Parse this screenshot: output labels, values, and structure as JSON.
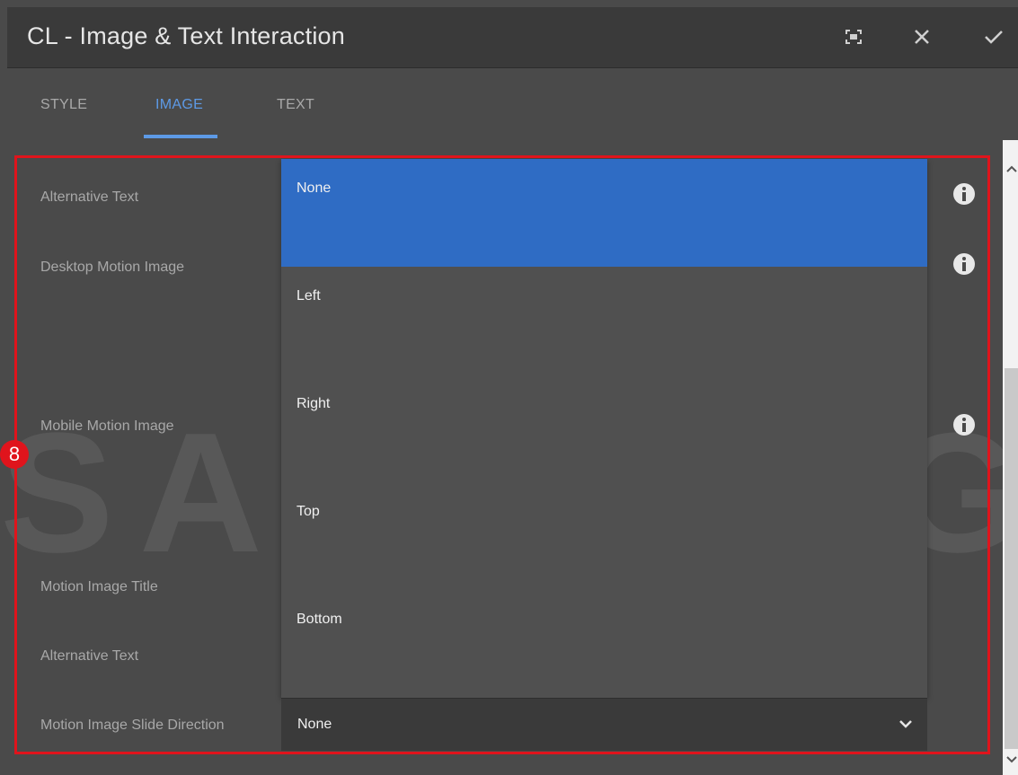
{
  "dialog": {
    "title": "CL - Image & Text Interaction",
    "fullscreen_icon": "fullscreen-icon",
    "close_icon": "close-icon",
    "confirm_icon": "check-icon"
  },
  "tabs": [
    {
      "label": "STYLE"
    },
    {
      "label": "IMAGE"
    },
    {
      "label": "TEXT"
    }
  ],
  "fields": [
    {
      "label": "Alternative Text"
    },
    {
      "label": "Desktop Motion Image"
    },
    {
      "label": "Mobile Motion Image"
    },
    {
      "label": "Motion Image Title"
    },
    {
      "label": "Alternative Text"
    },
    {
      "label": "Motion Image Slide Direction"
    }
  ],
  "dropdown": {
    "options": [
      {
        "label": "None"
      },
      {
        "label": "Left"
      },
      {
        "label": "Right"
      },
      {
        "label": "Top"
      },
      {
        "label": "Bottom"
      }
    ],
    "selected_value": "None"
  },
  "annotation": {
    "step_number": "8",
    "color": "#e0141c"
  },
  "watermark": "SAMSUNG",
  "colors": {
    "accent": "#5d9ae6",
    "selected_option": "#2f6cc4"
  }
}
